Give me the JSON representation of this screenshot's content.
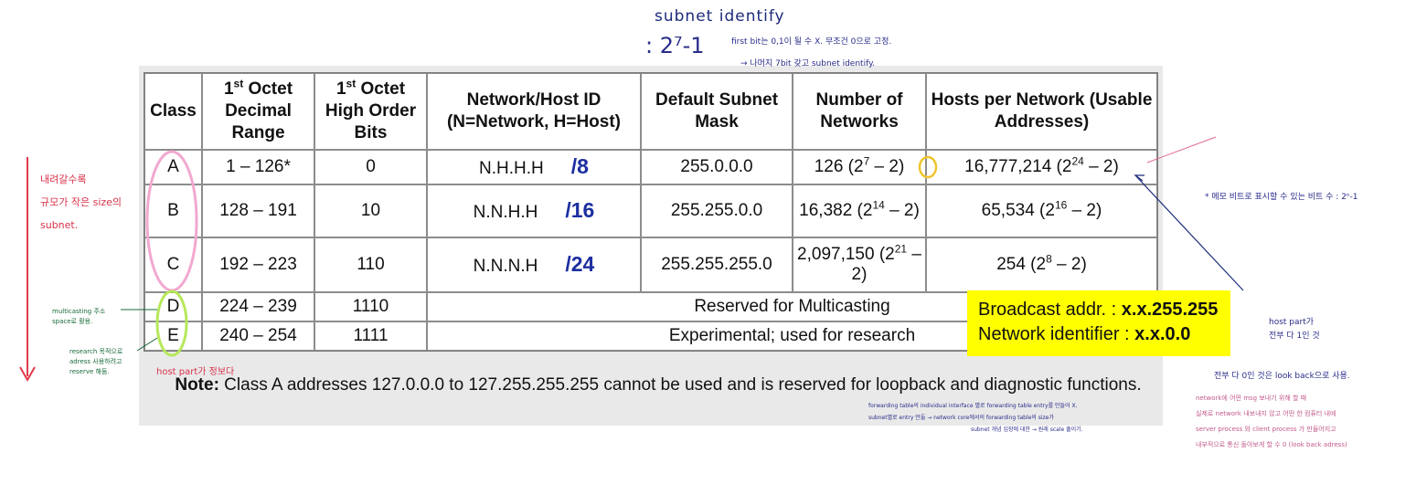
{
  "table": {
    "headers": [
      {
        "main": "Class"
      },
      {
        "sup_prefix": "1",
        "sup": "st",
        "main": " Octet Decimal Range"
      },
      {
        "sup_prefix": "1",
        "sup": "st",
        "main": " Octet High Order Bits"
      },
      {
        "main": "Network/Host ID (N=Network, H=Host)"
      },
      {
        "main": "Default Subnet Mask"
      },
      {
        "main": "Number of Networks"
      },
      {
        "main": "Hosts per Network (Usable Addresses)"
      }
    ],
    "rows": [
      {
        "class": "A",
        "range": "1 – 126*",
        "bits": "0",
        "nh": "N.H.H.H",
        "prefix": "/8",
        "mask": "255.0.0.0",
        "nets": {
          "pre": "126 (2",
          "exp": "7",
          "post": " – 2)"
        },
        "hosts": {
          "pre": "16,777,214 (2",
          "exp": "24",
          "post": " – 2)"
        }
      },
      {
        "class": "B",
        "range": "128 – 191",
        "bits": "10",
        "nh": "N.N.H.H",
        "prefix": "/16",
        "mask": "255.255.0.0",
        "nets": {
          "pre": "16,382 (2",
          "exp": "14",
          "post": " – 2)"
        },
        "hosts": {
          "pre": "65,534 (2",
          "exp": "16",
          "post": " – 2)"
        }
      },
      {
        "class": "C",
        "range": "192 – 223",
        "bits": "110",
        "nh": "N.N.N.H",
        "prefix": "/24",
        "mask": "255.255.255.0",
        "nets": {
          "pre": "2,097,150 (2",
          "exp": "21",
          "post": " – 2)"
        },
        "hosts": {
          "pre": "254 (2",
          "exp": "8",
          "post": " – 2)"
        }
      },
      {
        "class": "D",
        "range": "224 – 239",
        "bits": "1110",
        "span": "Reserved for Multicasting"
      },
      {
        "class": "E",
        "range": "240 – 254",
        "bits": "1111",
        "span": "Experimental; used for research"
      }
    ]
  },
  "note": {
    "label": "Note:",
    "text": " Class A addresses 127.0.0.0 to 127.255.255.255 cannot be used and is reserved for loopback and diagnostic functions."
  },
  "yellow_box": {
    "line1_label": "Broadcast addr. : ",
    "line1_value": "x.x.255.255",
    "line2_label": "Network identifier : ",
    "line2_value": "x.x.0.0"
  },
  "annotations": {
    "subnet_identify": "subnet identify",
    "formula": ": 2⁷-1",
    "top_note1": "first bit는 0,1이 될 수 X. 무조건 0으로 고정.",
    "top_note2": "→ 나머지 7bit 갖고 subnet identify.",
    "left_red": [
      "내려갈수록",
      "규모가 작은 size의",
      "subnet."
    ],
    "multicast_note": [
      "multicasting 주소",
      "space로 활용."
    ],
    "research_note": [
      "research 목적으로",
      "adress 사용하려고",
      "reserve 해둠."
    ],
    "hostpart_red": "host part가 정보다",
    "right_note1": "* 메모 비트로 표시할 수 있는 비트 수 : 2ⁿ-1",
    "right_note2": "host part가",
    "right_note3": "전부 다 1인 것",
    "right_note4": "전부 다 0인 것은 look back으로 사용.",
    "bottom_notes": [
      "forwarding table의 individual interface 별로 forwarding table entry를 만들어 X.",
      "subnet별로 entry 만듦 → network core에서의 forwarding table의 size가",
      "subnet 개념 입장에 대한 → 원래 scale 줄이기."
    ],
    "bottom_right": [
      "network에 어떤 msg 보내기 위해 할 때",
      "실제로 network 내보내지 않고 어떤 한 컴퓨터 내에",
      "server process 와 client process 가 만들어지고",
      "내부적으로 통신 돌아보게 할 수 0 (look back adress)"
    ]
  }
}
